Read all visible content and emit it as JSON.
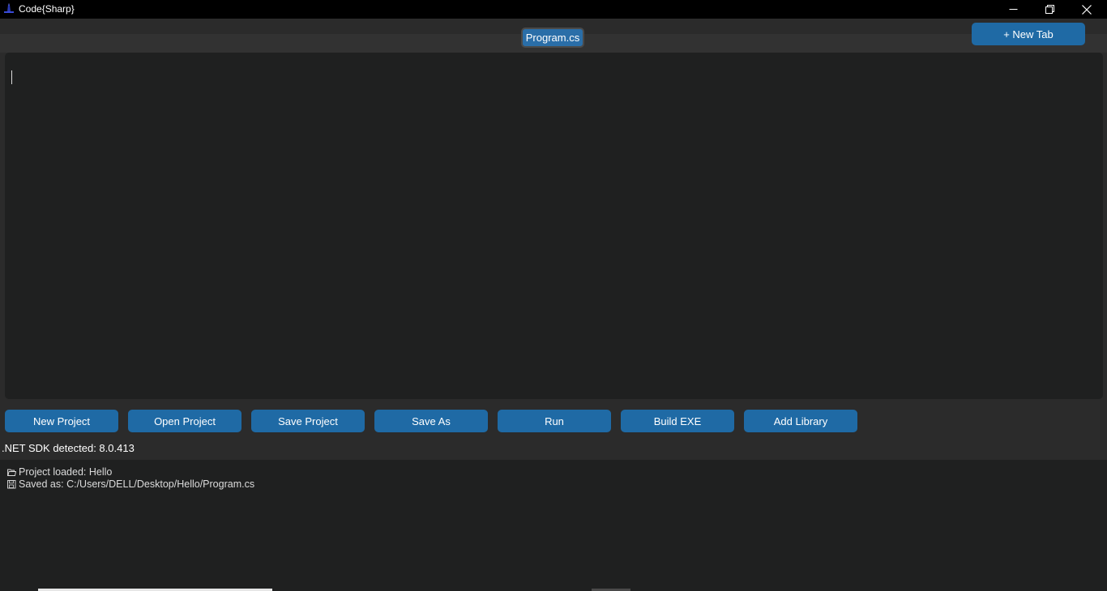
{
  "window": {
    "title": "Code{Sharp}",
    "icon": "app-logo-icon",
    "controls": [
      "minimize-icon",
      "restore-icon",
      "close-icon"
    ]
  },
  "tabs": {
    "active_tab": "Program.cs",
    "new_tab_label": "+ New Tab"
  },
  "editor": {
    "content": ""
  },
  "toolbar": {
    "new_project": "New Project",
    "open_project": "Open Project",
    "save_project": "Save Project",
    "save_as": "Save As",
    "run": "Run",
    "build_exe": "Build EXE",
    "add_library": "Add Library"
  },
  "status": {
    "sdk": ".NET SDK detected: 8.0.413"
  },
  "output": {
    "lines": [
      {
        "icon": "folder-icon",
        "text": "Project loaded: Hello"
      },
      {
        "icon": "save-icon",
        "text": "Saved as: C:/Users/DELL/Desktop/Hello/Program.cs"
      }
    ]
  },
  "colors": {
    "accent": "#1f6aa5",
    "titlebar": "#000000",
    "background": "#2b2b2b",
    "panel": "#1f2020"
  }
}
